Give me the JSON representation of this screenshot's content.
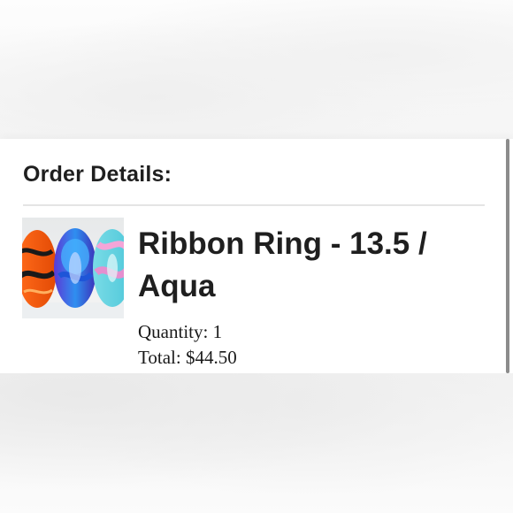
{
  "order": {
    "heading": "Order Details:",
    "item": {
      "title": "Ribbon Ring - 13.5 / Aqua",
      "quantity_label": "Quantity:",
      "quantity": "1",
      "total_label": "Total:",
      "total": "$44.50",
      "image_icon": "glass-bead-product-image"
    }
  },
  "colors": {
    "text": "#1f1f1f",
    "divider": "#e4e4e4",
    "background": "#ffffff"
  }
}
